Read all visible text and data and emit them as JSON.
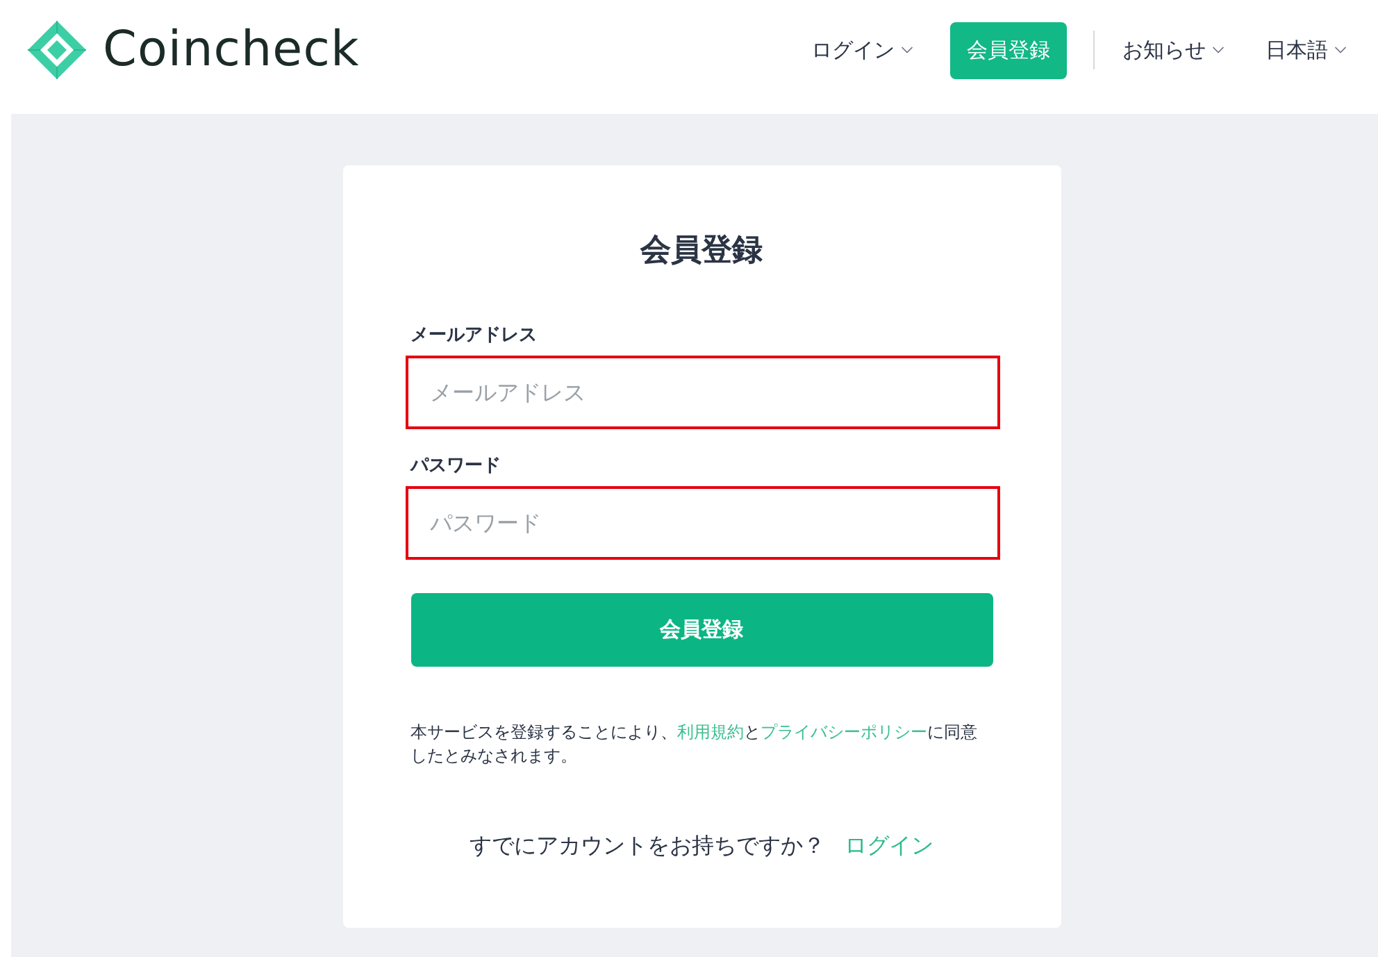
{
  "header": {
    "logo": {
      "text": "Coincheck"
    },
    "nav": [
      {
        "kind": "dropdown",
        "label": "ログイン"
      },
      {
        "kind": "button",
        "label": "会員登録"
      },
      {
        "kind": "dropdown",
        "label": "お知らせ"
      },
      {
        "kind": "dropdown",
        "label": "日本語"
      }
    ]
  },
  "form": {
    "title": "会員登録",
    "fields": [
      {
        "label": "メールアドレス",
        "placeholder": "メールアドレス",
        "highlighted": true
      },
      {
        "label": "パスワード",
        "placeholder": "パスワード",
        "highlighted": true
      }
    ],
    "submit": "会員登録",
    "terms": [
      {
        "kind": "text",
        "text": "本サービスを登録することにより、"
      },
      {
        "kind": "link",
        "text": "利用規約"
      },
      {
        "kind": "text",
        "text": "と"
      },
      {
        "kind": "link",
        "text": "プライバシーポリシー"
      },
      {
        "kind": "text",
        "text": "に同意したとみなされます。"
      }
    ],
    "login_prompt": {
      "text": "すでにアカウントをお持ちですか？",
      "link": "ログイン"
    }
  }
}
